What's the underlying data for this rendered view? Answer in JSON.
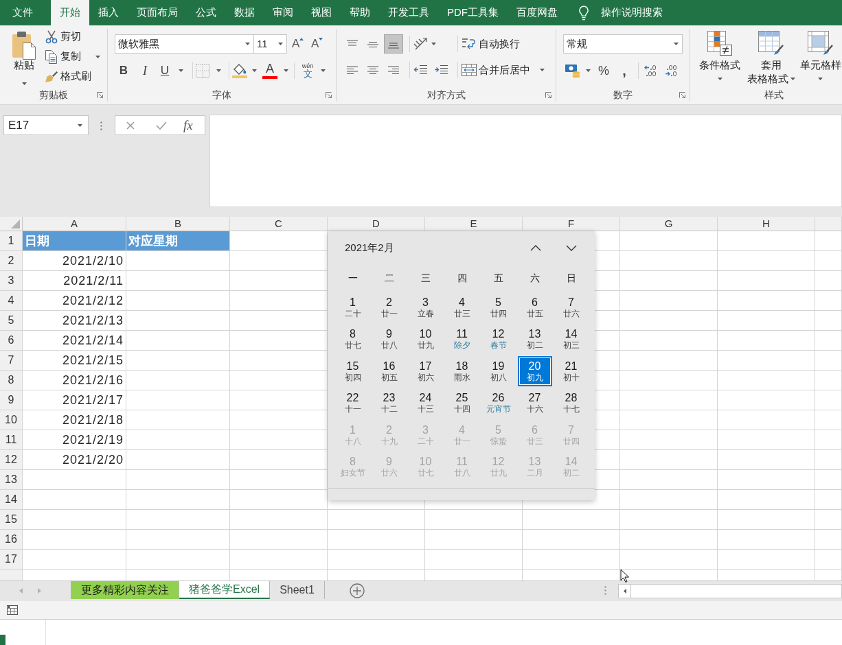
{
  "menu_tabs": [
    {
      "label": "文件",
      "selected": false
    },
    {
      "label": "开始",
      "selected": true
    },
    {
      "label": "插入",
      "selected": false
    },
    {
      "label": "页面布局",
      "selected": false
    },
    {
      "label": "公式",
      "selected": false
    },
    {
      "label": "数据",
      "selected": false
    },
    {
      "label": "审阅",
      "selected": false
    },
    {
      "label": "视图",
      "selected": false
    },
    {
      "label": "帮助",
      "selected": false
    },
    {
      "label": "开发工具",
      "selected": false
    },
    {
      "label": "PDF工具集",
      "selected": false
    },
    {
      "label": "百度网盘",
      "selected": false
    }
  ],
  "tell_me": {
    "placeholder": "操作说明搜索"
  },
  "ribbon": {
    "clipboard": {
      "title": "剪贴板",
      "paste": "粘贴",
      "cut": "剪切",
      "copy": "复制",
      "format_painter": "格式刷"
    },
    "font": {
      "title": "字体",
      "font_name": "微软雅黑",
      "font_size": "11",
      "grow_font": "A",
      "shrink_font": "A",
      "bold": "B",
      "italic": "I",
      "underline": "U",
      "font_color": "A",
      "phonetic_guide": {
        "pinyin": "wén",
        "glyph": "文"
      }
    },
    "alignment": {
      "title": "对齐方式",
      "vertical": [
        {
          "kind": "top",
          "selected": false
        },
        {
          "kind": "middle",
          "selected": false
        },
        {
          "kind": "bottom",
          "selected": true
        }
      ],
      "horizontal": [
        {
          "kind": "left",
          "selected": false
        },
        {
          "kind": "center",
          "selected": false
        },
        {
          "kind": "right",
          "selected": false
        }
      ],
      "wrap_text": "自动换行",
      "merge_center": "合并后居中"
    },
    "number": {
      "title": "数字",
      "format": "常规",
      "percent": "%",
      "comma": ","
    },
    "styles": {
      "title": "样式",
      "conditional_formatting": "条件格式",
      "format_as_table": [
        "套用",
        "表格格式"
      ],
      "cell_styles": "单元格样"
    }
  },
  "formula_bar": {
    "name_box": "E17",
    "function_button": "fx"
  },
  "sheet": {
    "columns": [
      "A",
      "B",
      "C",
      "D",
      "E",
      "F",
      "G",
      "H"
    ],
    "row_numbers": [
      "1",
      "2",
      "3",
      "4",
      "5",
      "6",
      "7",
      "8",
      "9",
      "10",
      "11",
      "12",
      "13",
      "14",
      "15",
      "16",
      "17"
    ],
    "header": [
      "日期",
      "对应星期"
    ],
    "rows": [
      [
        "2021/2/10"
      ],
      [
        "2021/2/11"
      ],
      [
        "2021/2/12"
      ],
      [
        "2021/2/13"
      ],
      [
        "2021/2/14"
      ],
      [
        "2021/2/15"
      ],
      [
        "2021/2/16"
      ],
      [
        "2021/2/17"
      ],
      [
        "2021/2/18"
      ],
      [
        "2021/2/19"
      ],
      [
        "2021/2/20"
      ]
    ]
  },
  "date_picker": {
    "title": "2021年2月",
    "weekdays": [
      "一",
      "二",
      "三",
      "四",
      "五",
      "六",
      "日"
    ],
    "days": [
      {
        "day": "1",
        "lunar": "二十",
        "in_month": true,
        "festival": false,
        "selected": false
      },
      {
        "day": "2",
        "lunar": "廿一",
        "in_month": true,
        "festival": false,
        "selected": false
      },
      {
        "day": "3",
        "lunar": "立春",
        "in_month": true,
        "festival": false,
        "selected": false
      },
      {
        "day": "4",
        "lunar": "廿三",
        "in_month": true,
        "festival": false,
        "selected": false
      },
      {
        "day": "5",
        "lunar": "廿四",
        "in_month": true,
        "festival": false,
        "selected": false
      },
      {
        "day": "6",
        "lunar": "廿五",
        "in_month": true,
        "festival": false,
        "selected": false
      },
      {
        "day": "7",
        "lunar": "廿六",
        "in_month": true,
        "festival": false,
        "selected": false
      },
      {
        "day": "8",
        "lunar": "廿七",
        "in_month": true,
        "festival": false,
        "selected": false
      },
      {
        "day": "9",
        "lunar": "廿八",
        "in_month": true,
        "festival": false,
        "selected": false
      },
      {
        "day": "10",
        "lunar": "廿九",
        "in_month": true,
        "festival": false,
        "selected": false
      },
      {
        "day": "11",
        "lunar": "除夕",
        "in_month": true,
        "festival": true,
        "selected": false
      },
      {
        "day": "12",
        "lunar": "春节",
        "in_month": true,
        "festival": true,
        "selected": false
      },
      {
        "day": "13",
        "lunar": "初二",
        "in_month": true,
        "festival": false,
        "selected": false
      },
      {
        "day": "14",
        "lunar": "初三",
        "in_month": true,
        "festival": false,
        "selected": false
      },
      {
        "day": "15",
        "lunar": "初四",
        "in_month": true,
        "festival": false,
        "selected": false
      },
      {
        "day": "16",
        "lunar": "初五",
        "in_month": true,
        "festival": false,
        "selected": false
      },
      {
        "day": "17",
        "lunar": "初六",
        "in_month": true,
        "festival": false,
        "selected": false
      },
      {
        "day": "18",
        "lunar": "雨水",
        "in_month": true,
        "festival": false,
        "selected": false
      },
      {
        "day": "19",
        "lunar": "初八",
        "in_month": true,
        "festival": false,
        "selected": false
      },
      {
        "day": "20",
        "lunar": "初九",
        "in_month": true,
        "festival": false,
        "selected": true
      },
      {
        "day": "21",
        "lunar": "初十",
        "in_month": true,
        "festival": false,
        "selected": false
      },
      {
        "day": "22",
        "lunar": "十一",
        "in_month": true,
        "festival": false,
        "selected": false
      },
      {
        "day": "23",
        "lunar": "十二",
        "in_month": true,
        "festival": false,
        "selected": false
      },
      {
        "day": "24",
        "lunar": "十三",
        "in_month": true,
        "festival": false,
        "selected": false
      },
      {
        "day": "25",
        "lunar": "十四",
        "in_month": true,
        "festival": false,
        "selected": false
      },
      {
        "day": "26",
        "lunar": "元宵节",
        "in_month": true,
        "festival": true,
        "selected": false
      },
      {
        "day": "27",
        "lunar": "十六",
        "in_month": true,
        "festival": false,
        "selected": false
      },
      {
        "day": "28",
        "lunar": "十七",
        "in_month": true,
        "festival": false,
        "selected": false
      },
      {
        "day": "1",
        "lunar": "十八",
        "in_month": false,
        "festival": false,
        "selected": false
      },
      {
        "day": "2",
        "lunar": "十九",
        "in_month": false,
        "festival": false,
        "selected": false
      },
      {
        "day": "3",
        "lunar": "二十",
        "in_month": false,
        "festival": false,
        "selected": false
      },
      {
        "day": "4",
        "lunar": "廿一",
        "in_month": false,
        "festival": false,
        "selected": false
      },
      {
        "day": "5",
        "lunar": "惊蛰",
        "in_month": false,
        "festival": false,
        "selected": false
      },
      {
        "day": "6",
        "lunar": "廿三",
        "in_month": false,
        "festival": false,
        "selected": false
      },
      {
        "day": "7",
        "lunar": "廿四",
        "in_month": false,
        "festival": false,
        "selected": false
      },
      {
        "day": "8",
        "lunar": "妇女节",
        "in_month": false,
        "festival": false,
        "selected": false
      },
      {
        "day": "9",
        "lunar": "廿六",
        "in_month": false,
        "festival": false,
        "selected": false
      },
      {
        "day": "10",
        "lunar": "廿七",
        "in_month": false,
        "festival": false,
        "selected": false
      },
      {
        "day": "11",
        "lunar": "廿八",
        "in_month": false,
        "festival": false,
        "selected": false
      },
      {
        "day": "12",
        "lunar": "廿九",
        "in_month": false,
        "festival": false,
        "selected": false
      },
      {
        "day": "13",
        "lunar": "二月",
        "in_month": false,
        "festival": false,
        "selected": false
      },
      {
        "day": "14",
        "lunar": "初二",
        "in_month": false,
        "festival": false,
        "selected": false
      }
    ]
  },
  "sheet_tabs": [
    {
      "label": "更多精彩内容关注",
      "selected": false,
      "color": "#92d050"
    },
    {
      "label": "猪爸爸学Excel",
      "selected": true
    },
    {
      "label": "Sheet1",
      "selected": false
    }
  ]
}
